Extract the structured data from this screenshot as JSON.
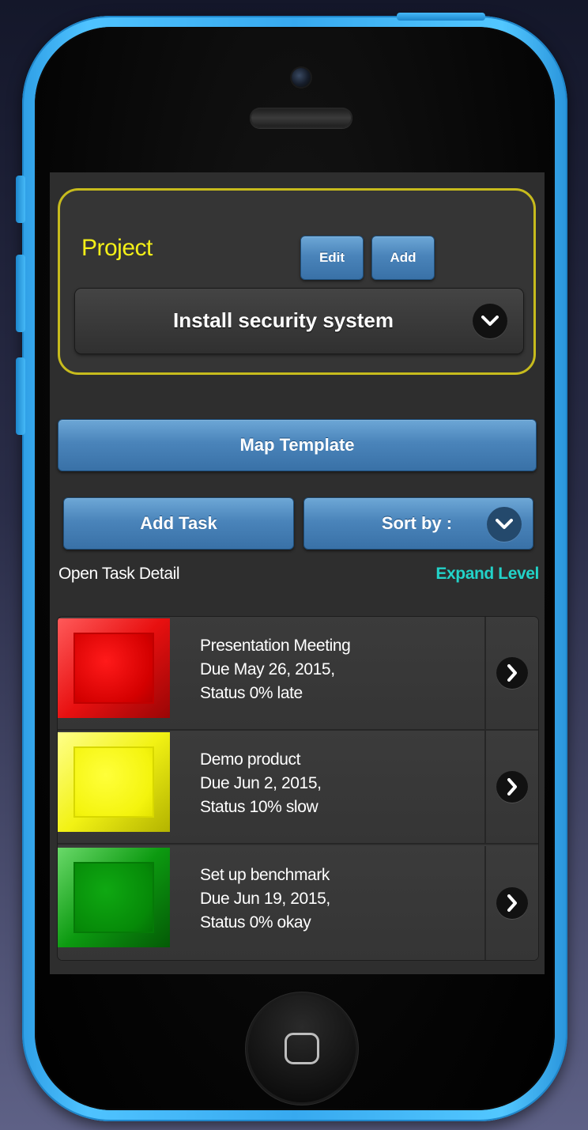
{
  "project": {
    "title": "Project",
    "edit_label": "Edit",
    "add_label": "Add",
    "selected": "Install security system"
  },
  "actions": {
    "map_template_label": "Map Template",
    "add_task_label": "Add Task",
    "sort_label": "Sort by :"
  },
  "links": {
    "open_task_detail": "Open Task Detail",
    "expand_level": "Expand Level"
  },
  "tasks": [
    {
      "name": "Presentation Meeting",
      "due": "Due May 26, 2015,",
      "status": "Status 0% late",
      "color": "#e81010"
    },
    {
      "name": "Demo product",
      "due": "Due Jun 2, 2015,",
      "status": "Status 10% slow",
      "color": "#f2f214"
    },
    {
      "name": "Set up benchmark",
      "due": "Due Jun 19, 2015,",
      "status": "Status 0% okay",
      "color": "#0c9a10"
    }
  ],
  "colors": {
    "accent_yellow": "#f3ef18",
    "accent_teal": "#22d3c9",
    "button_blue": "#4a84ba",
    "phone_body": "#37a9ef"
  }
}
